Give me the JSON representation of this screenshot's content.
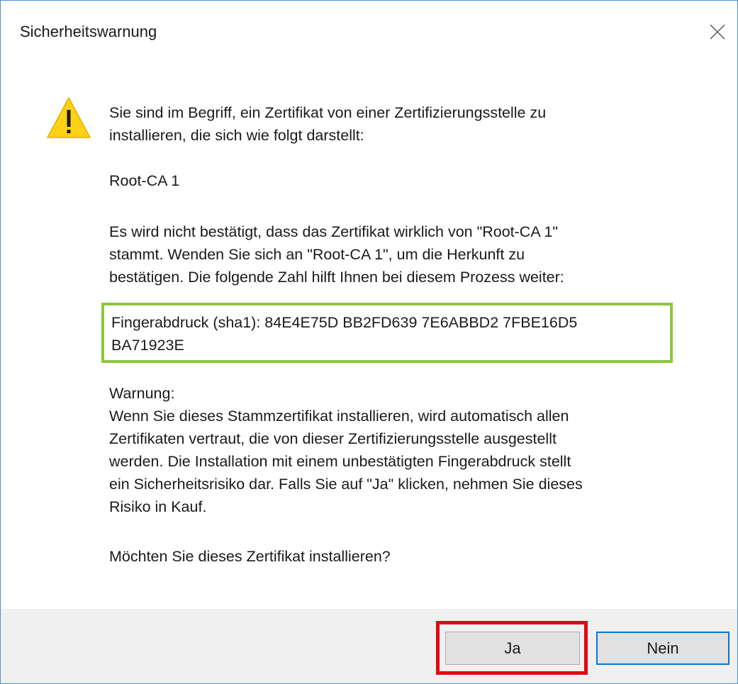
{
  "window": {
    "title": "Sicherheitswarnung",
    "close_icon": "close-icon"
  },
  "content": {
    "icon": "warning-triangle-icon",
    "intro": "Sie sind im Begriff, ein Zertifikat von einer Zertifizierungsstelle zu\ninstallieren, die sich wie folgt darstellt:",
    "ca_name": "Root-CA 1",
    "verification_note": "Es wird nicht bestätigt, dass das Zertifikat wirklich von \"Root-CA 1\"\nstammt. Wenden Sie sich an \"Root-CA 1\", um die Herkunft zu\nbestätigen. Die folgende Zahl hilft Ihnen bei diesem Prozess weiter:",
    "fingerprint": "Fingerabdruck (sha1): 84E4E75D BB2FD639 7E6ABBD2 7FBE16D5\nBA71923E",
    "warning": "Warnung:\nWenn Sie dieses Stammzertifikat installieren, wird automatisch allen\nZertifikaten vertraut, die von dieser Zertifizierungsstelle ausgestellt\nwerden. Die Installation mit einem unbestätigten Fingerabdruck stellt\nein Sicherheitsrisiko dar. Falls Sie auf \"Ja\" klicken, nehmen Sie dieses\nRisiko in Kauf.",
    "question": "Möchten Sie dieses Zertifikat installieren?"
  },
  "buttons": {
    "yes_label": "Ja",
    "no_label": "Nein"
  },
  "colors": {
    "window_border": "#4a8fd6",
    "footer_background": "#f0f0f0",
    "fingerprint_highlight": "#8dc63f",
    "yes_highlight": "#e30613",
    "default_button_border": "#0078d7",
    "warning_icon_fill": "#fcd116"
  }
}
